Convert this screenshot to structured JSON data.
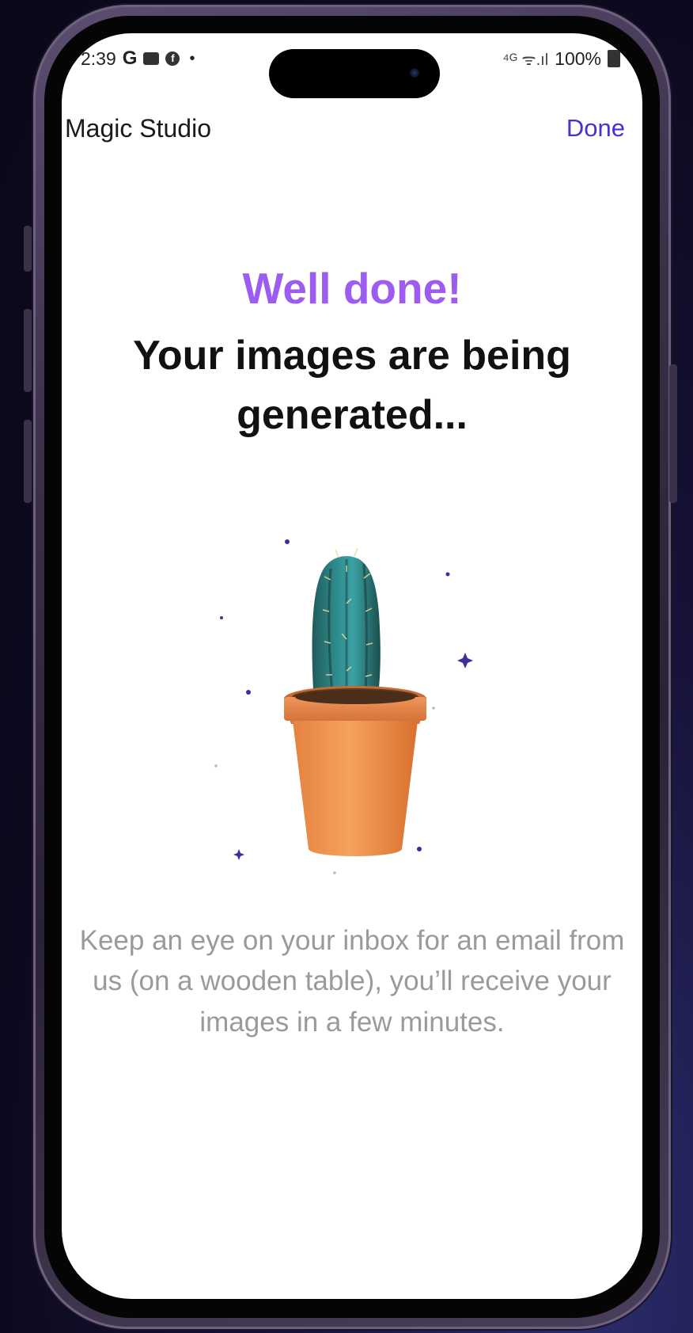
{
  "status_bar": {
    "time": "2:39",
    "g_icon": "G",
    "fb_icon": "f",
    "dot": "•",
    "network": "⁴ᴳ ᯤ.ıl",
    "battery": "100%"
  },
  "header": {
    "title": "Magic Studio",
    "done_label": "Done"
  },
  "main": {
    "headline": "Well done!",
    "subheadline": "Your images are being generated...",
    "message": "Keep an eye on your inbox for an email from us (on a wooden table), you’ll receive your images in a few minutes."
  },
  "colors": {
    "accent_purple": "#9c5cf0",
    "done_blue": "#4b2fd0",
    "message_gray": "#9a9a9a"
  },
  "icons": [
    "cactus-pot-illustration",
    "sparkle-star-icon",
    "battery-icon",
    "signal-icon"
  ]
}
